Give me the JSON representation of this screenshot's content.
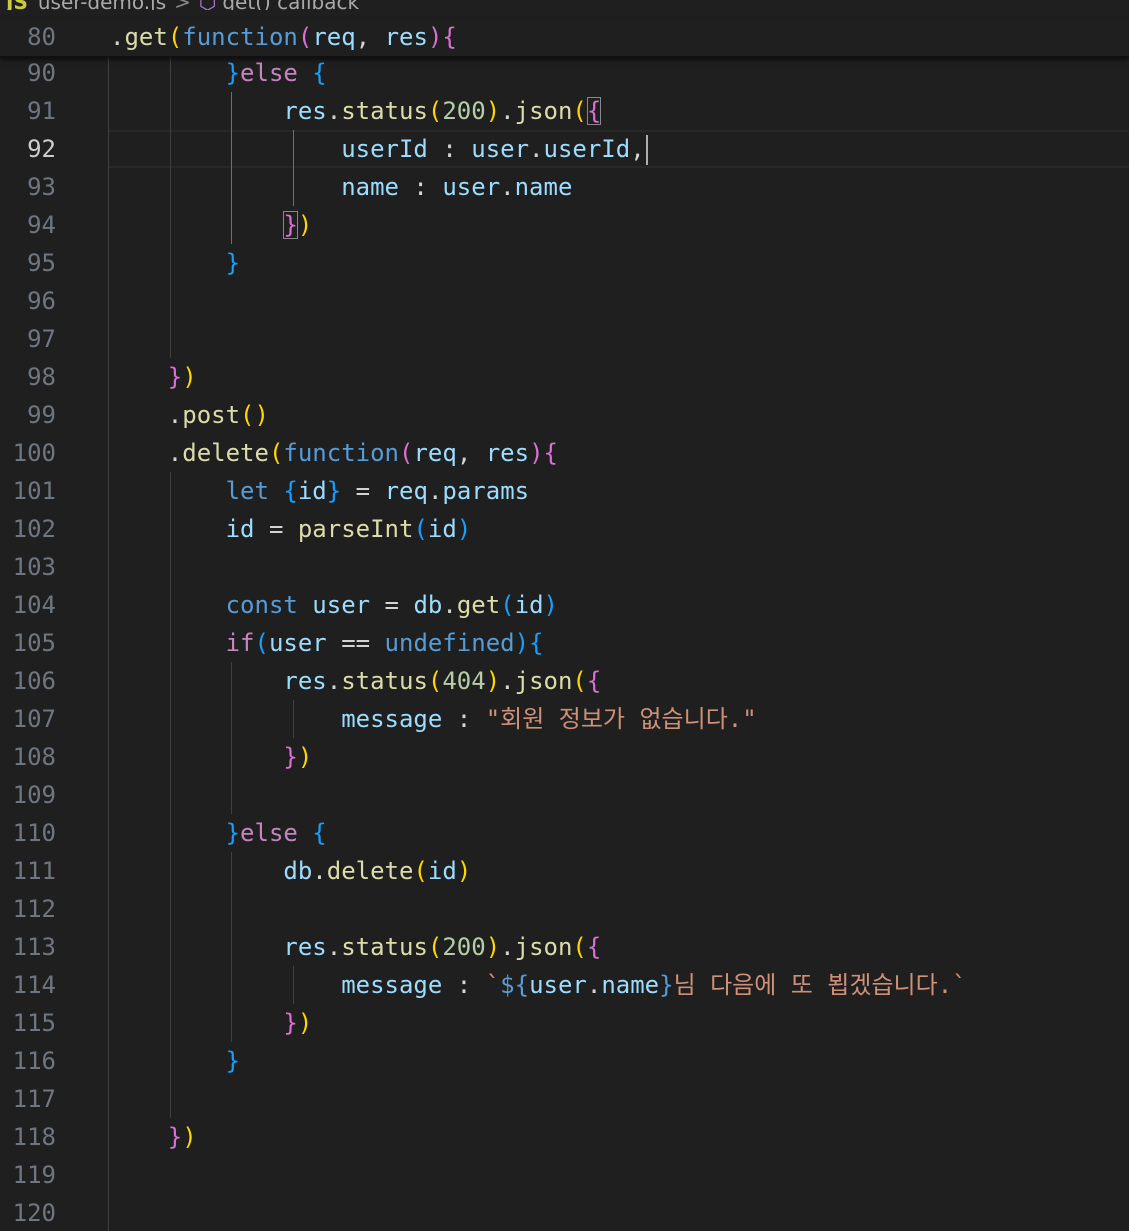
{
  "breadcrumb": {
    "file_icon": "JS",
    "file": "user-demo.js",
    "separator": ">",
    "symbol_icon": "cube-icon",
    "symbol": "get() callback"
  },
  "sticky": {
    "ln": "80",
    "code": ".get(function(req, res){"
  },
  "lines": [
    {
      "n": "90",
      "code": "}else {"
    },
    {
      "n": "91",
      "code": "res.status(200).json({"
    },
    {
      "n": "92",
      "code": "userId : user.userId,"
    },
    {
      "n": "93",
      "code": "name : user.name"
    },
    {
      "n": "94",
      "code": "})"
    },
    {
      "n": "95",
      "code": "}"
    },
    {
      "n": "96",
      "code": ""
    },
    {
      "n": "97",
      "code": ""
    },
    {
      "n": "98",
      "code": "})"
    },
    {
      "n": "99",
      "code": ".post()"
    },
    {
      "n": "100",
      "code": ".delete(function(req, res){"
    },
    {
      "n": "101",
      "code": "let {id} = req.params"
    },
    {
      "n": "102",
      "code": "id = parseInt(id)"
    },
    {
      "n": "103",
      "code": ""
    },
    {
      "n": "104",
      "code": "const user = db.get(id)"
    },
    {
      "n": "105",
      "code": "if(user == undefined){"
    },
    {
      "n": "106",
      "code": "res.status(404).json({"
    },
    {
      "n": "107",
      "code": "message : \"회원 정보가 없습니다.\""
    },
    {
      "n": "108",
      "code": "})"
    },
    {
      "n": "109",
      "code": ""
    },
    {
      "n": "110",
      "code": "}else {"
    },
    {
      "n": "111",
      "code": "db.delete(id)"
    },
    {
      "n": "112",
      "code": ""
    },
    {
      "n": "113",
      "code": "res.status(200).json({"
    },
    {
      "n": "114",
      "code": "message : `${user.name}님 다음에 또 뵙겠습니다.`"
    },
    {
      "n": "115",
      "code": "})"
    },
    {
      "n": "116",
      "code": "}"
    },
    {
      "n": "117",
      "code": ""
    },
    {
      "n": "118",
      "code": "})"
    },
    {
      "n": "119",
      "code": ""
    },
    {
      "n": "120",
      "code": ""
    }
  ],
  "current_line": "92",
  "colors": {
    "background": "#1f1f1f",
    "keyword": "#569cd6",
    "control": "#c586c0",
    "function": "#dcdcaa",
    "variable": "#9cdcfe",
    "number": "#b5cea8",
    "string": "#ce9178"
  }
}
